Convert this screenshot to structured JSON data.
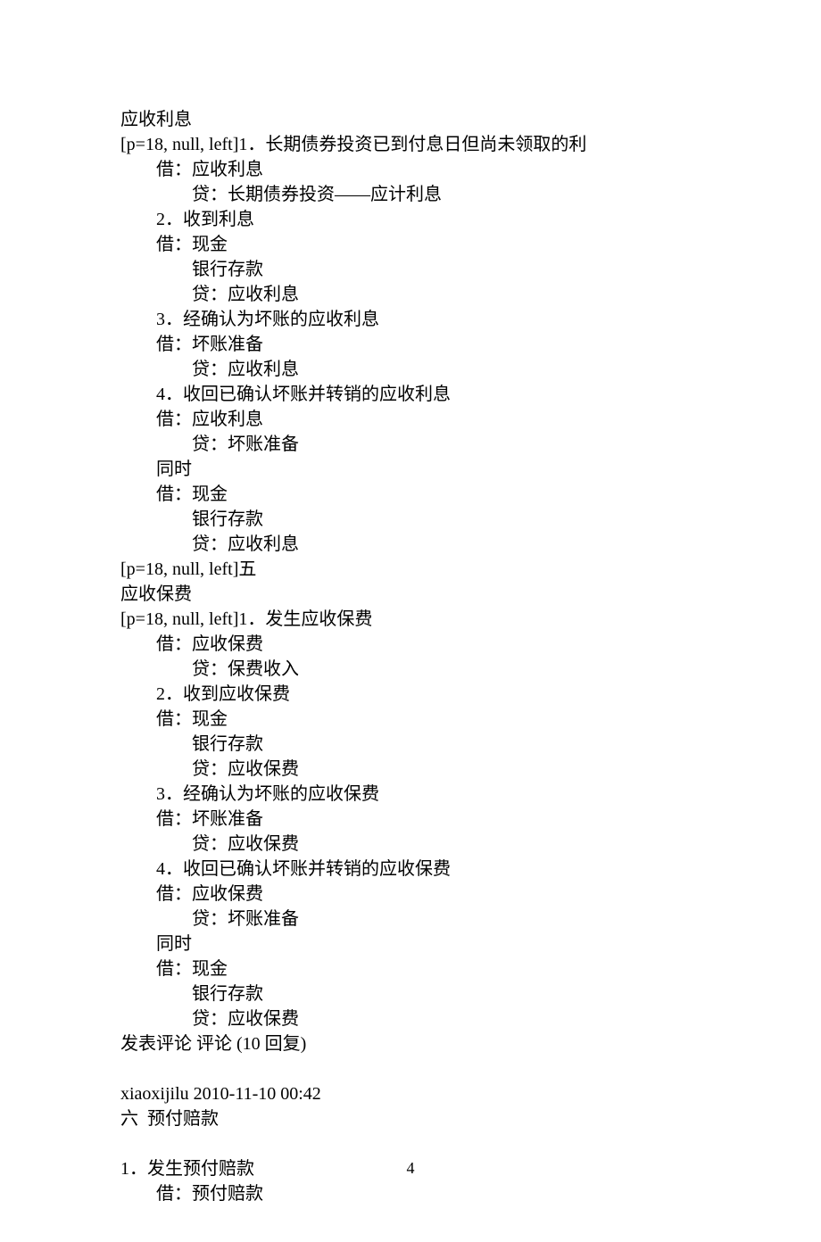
{
  "lines": [
    {
      "text": "应收利息",
      "indent": 0
    },
    {
      "text": "[p=18, null, left]1．长期债券投资已到付息日但尚未领取的利",
      "indent": 0
    },
    {
      "text": "借：应收利息",
      "indent": 1
    },
    {
      "text": "贷：长期债券投资——应计利息",
      "indent": 2
    },
    {
      "text": "2．收到利息",
      "indent": 1
    },
    {
      "text": "借：现金",
      "indent": 1
    },
    {
      "text": "银行存款",
      "indent": 2
    },
    {
      "text": "贷：应收利息",
      "indent": 2
    },
    {
      "text": "3．经确认为坏账的应收利息",
      "indent": 1
    },
    {
      "text": "借：坏账准备",
      "indent": 1
    },
    {
      "text": "贷：应收利息",
      "indent": 2
    },
    {
      "text": "4．收回已确认坏账并转销的应收利息",
      "indent": 1
    },
    {
      "text": "借：应收利息",
      "indent": 1
    },
    {
      "text": "贷：坏账准备",
      "indent": 2
    },
    {
      "text": "同时",
      "indent": 1
    },
    {
      "text": "借：现金",
      "indent": 1
    },
    {
      "text": "银行存款",
      "indent": 2
    },
    {
      "text": "贷：应收利息",
      "indent": 2
    },
    {
      "text": "[p=18, null, left]五",
      "indent": 0
    },
    {
      "text": "应收保费",
      "indent": 0
    },
    {
      "text": "[p=18, null, left]1．发生应收保费",
      "indent": 0
    },
    {
      "text": "借：应收保费",
      "indent": 1
    },
    {
      "text": "贷：保费收入",
      "indent": 2
    },
    {
      "text": "2．收到应收保费",
      "indent": 1
    },
    {
      "text": "借：现金",
      "indent": 1
    },
    {
      "text": "银行存款",
      "indent": 2
    },
    {
      "text": "贷：应收保费",
      "indent": 2
    },
    {
      "text": "3．经确认为坏账的应收保费",
      "indent": 1
    },
    {
      "text": "借：坏账准备",
      "indent": 1
    },
    {
      "text": "贷：应收保费",
      "indent": 2
    },
    {
      "text": "4．收回已确认坏账并转销的应收保费",
      "indent": 1
    },
    {
      "text": "借：应收保费",
      "indent": 1
    },
    {
      "text": "贷：坏账准备",
      "indent": 2
    },
    {
      "text": "同时",
      "indent": 1
    },
    {
      "text": "借：现金",
      "indent": 1
    },
    {
      "text": "银行存款",
      "indent": 2
    },
    {
      "text": "贷：应收保费",
      "indent": 2
    },
    {
      "text": "发表评论 评论 (10 回复)",
      "indent": 0
    },
    {
      "text": "",
      "indent": 0,
      "blank": true
    },
    {
      "text": "xiaoxijilu 2010-11-10 00:42",
      "indent": 0
    },
    {
      "text": "六  预付赔款",
      "indent": 0
    },
    {
      "text": "",
      "indent": 0,
      "blank": true
    },
    {
      "text": "1．发生预付赔款",
      "indent": 0
    },
    {
      "text": "借：预付赔款",
      "indent": 1
    }
  ],
  "pageNumber": "4"
}
